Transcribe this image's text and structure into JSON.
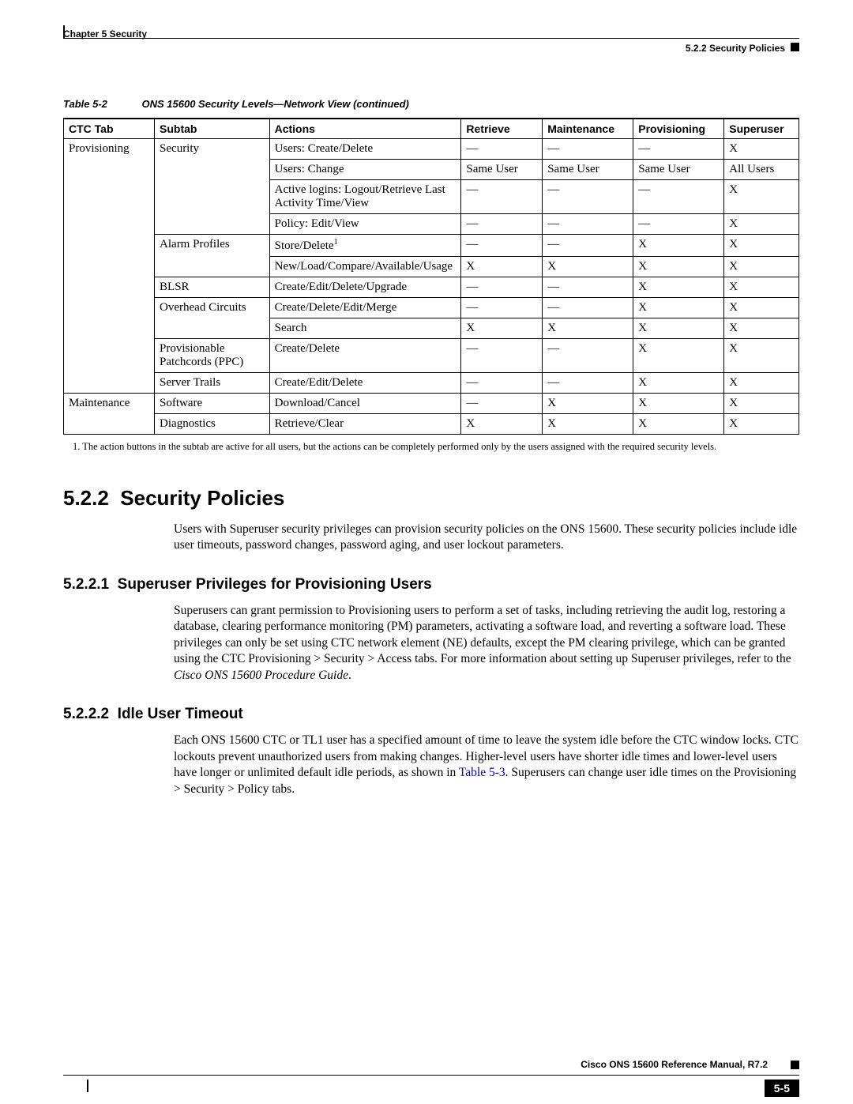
{
  "header": {
    "left": "Chapter 5    Security",
    "right": "5.2.2  Security Policies"
  },
  "table": {
    "label_num": "Table 5-2",
    "label_title": "ONS 15600 Security Levels—Network View (continued)",
    "headers": [
      "CTC Tab",
      "Subtab",
      "Actions",
      "Retrieve",
      "Maintenance",
      "Provisioning",
      "Superuser"
    ],
    "rows": {
      "r1": {
        "ctc": "Provisioning",
        "sub": "Security",
        "act": "Users: Create/Delete",
        "ret": "—",
        "mnt": "—",
        "prv": "—",
        "sup": "X"
      },
      "r2": {
        "act": "Users: Change",
        "ret": "Same User",
        "mnt": "Same User",
        "prv": "Same User",
        "sup": "All Users"
      },
      "r3": {
        "act": "Active logins: Logout/Retrieve Last Activity Time/View",
        "ret": "—",
        "mnt": "—",
        "prv": "—",
        "sup": "X"
      },
      "r4": {
        "act": "Policy: Edit/View",
        "ret": "—",
        "mnt": "—",
        "prv": "—",
        "sup": "X"
      },
      "r5": {
        "sub": "Alarm Profiles",
        "act": "Store/Delete",
        "foot": "1",
        "ret": "—",
        "mnt": "—",
        "prv": "X",
        "sup": "X"
      },
      "r6": {
        "act": "New/Load/Compare/Available/Usage",
        "ret": "X",
        "mnt": "X",
        "prv": "X",
        "sup": "X"
      },
      "r7": {
        "sub": "BLSR",
        "act": "Create/Edit/Delete/Upgrade",
        "ret": "—",
        "mnt": "—",
        "prv": "X",
        "sup": "X"
      },
      "r8": {
        "sub": "Overhead Circuits",
        "act": "Create/Delete/Edit/Merge",
        "ret": "—",
        "mnt": "—",
        "prv": "X",
        "sup": "X"
      },
      "r9": {
        "act": "Search",
        "ret": "X",
        "mnt": "X",
        "prv": "X",
        "sup": "X"
      },
      "r10": {
        "sub": "Provisionable Patchcords (PPC)",
        "act": "Create/Delete",
        "ret": "—",
        "mnt": "—",
        "prv": "X",
        "sup": "X"
      },
      "r11": {
        "sub": "Server Trails",
        "act": "Create/Edit/Delete",
        "ret": "—",
        "mnt": "—",
        "prv": "X",
        "sup": "X"
      },
      "r12": {
        "ctc": "Maintenance",
        "sub": "Software",
        "act": "Download/Cancel",
        "ret": "—",
        "mnt": "X",
        "prv": "X",
        "sup": "X"
      },
      "r13": {
        "sub": "Diagnostics",
        "act": "Retrieve/Clear",
        "ret": "X",
        "mnt": "X",
        "prv": "X",
        "sup": "X"
      }
    },
    "footnote": "1. The action buttons in the subtab are active for all users, but the actions can be completely performed only by the users assigned with the required security levels."
  },
  "sections": {
    "s1": {
      "num": "5.2.2",
      "title": "Security Policies",
      "para": "Users with Superuser security privileges can provision security policies on the ONS 15600. These security policies include idle user timeouts, password changes, password aging, and user lockout parameters."
    },
    "s2": {
      "num": "5.2.2.1",
      "title": "Superuser Privileges for Provisioning Users",
      "para_a": "Superusers can grant permission to Provisioning users to perform a set of tasks, including retrieving the audit log, restoring a database, clearing performance monitoring (PM) parameters, activating a software load, and reverting a software load. These privileges can only be set using CTC network element (NE) defaults, except the PM clearing privilege, which can be granted using the CTC Provisioning > Security > Access tabs. For more information about setting up Superuser privileges, refer to the ",
      "para_b_italic": "Cisco ONS 15600 Procedure Guide",
      "para_c": "."
    },
    "s3": {
      "num": "5.2.2.2",
      "title": "Idle User Timeout",
      "para_a": "Each ONS 15600 CTC or TL1 user has a specified amount of time to leave the system idle before the CTC window locks. CTC lockouts prevent unauthorized users from making changes. Higher-level users have shorter idle times and lower-level users have longer or unlimited default idle periods, as shown in ",
      "link": "Table 5-3",
      "para_b": ". Superusers can change user idle times on the Provisioning > Security > Policy tabs."
    }
  },
  "footer": {
    "title": "Cisco ONS 15600 Reference Manual, R7.2",
    "pagenum": "5-5"
  }
}
